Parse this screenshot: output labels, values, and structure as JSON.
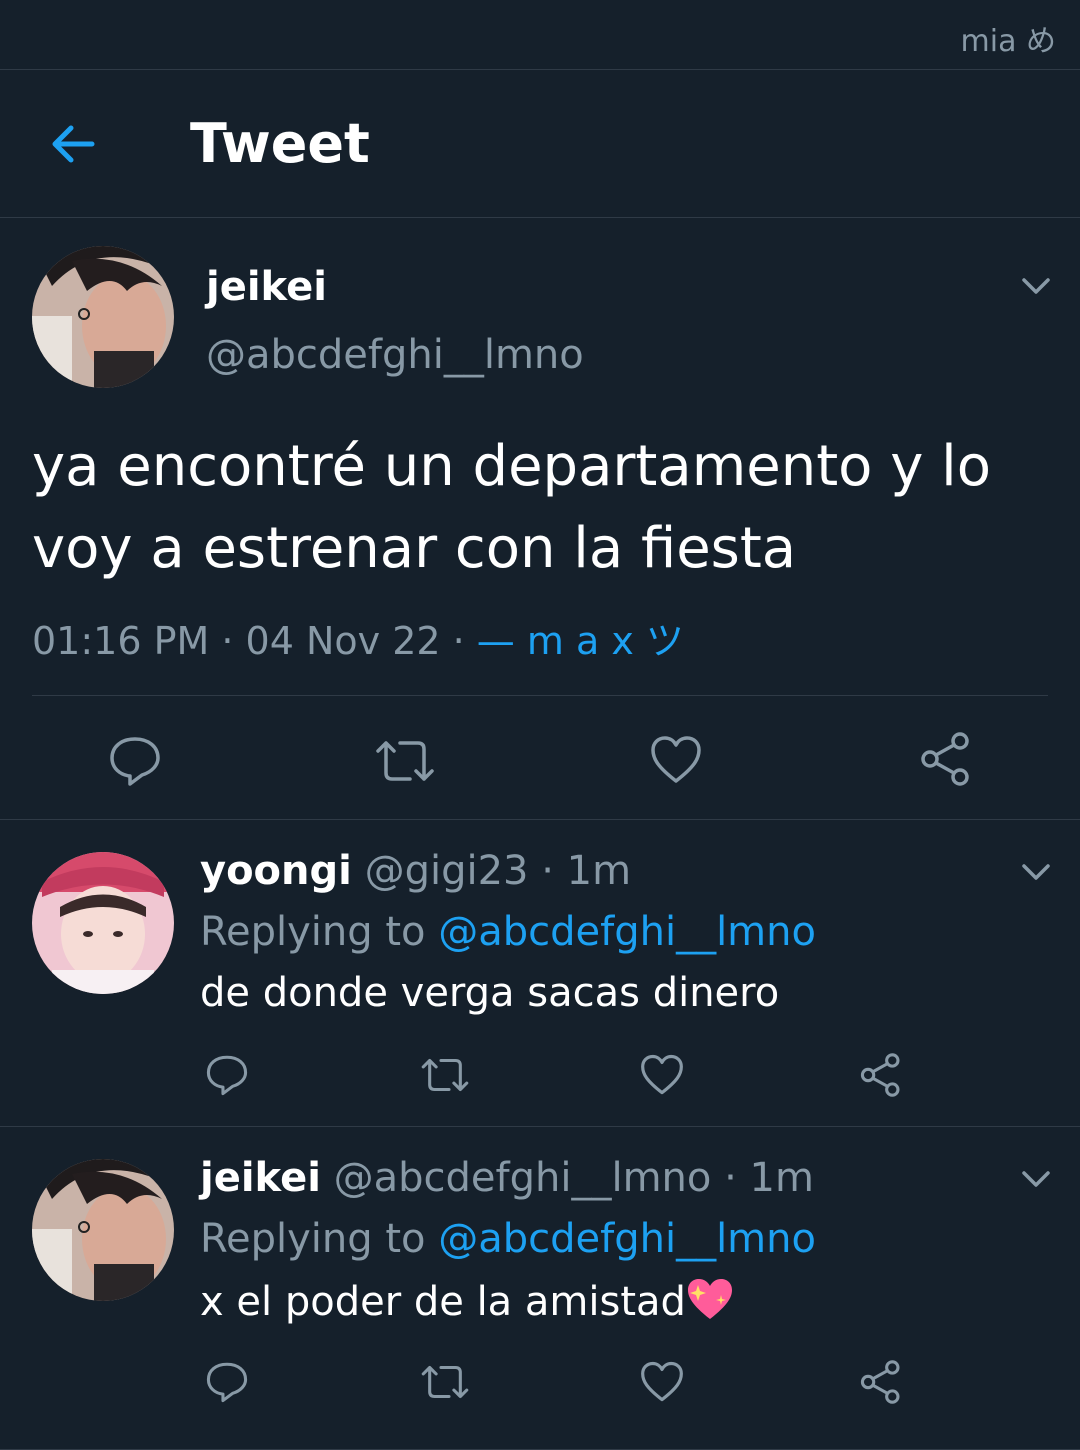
{
  "status_bar": {
    "text": "mia め"
  },
  "header": {
    "title": "Tweet",
    "back_icon": "arrow-left-icon"
  },
  "colors": {
    "background": "#15202b",
    "accent": "#1da1f2",
    "muted": "#8899a6",
    "divider": "#2f3a46"
  },
  "main_tweet": {
    "name": "jeikei",
    "handle": "@abcdefghi__lmno",
    "text": "ya encontré un departamento y lo voy a estrenar con la fiesta",
    "time_date": "01:16 PM · 04 Nov 22 · ",
    "source": "— m a x ツ"
  },
  "replies": [
    {
      "name": "yoongi",
      "handle_time": " @gigi23 · 1m",
      "replying_label": "Replying to ",
      "replying_to": "@abcdefghi__lmno",
      "text": "de donde verga sacas dinero"
    },
    {
      "name": "jeikei",
      "handle_time": " @abcdefghi__lmno · 1m",
      "replying_label": "Replying to ",
      "replying_to": "@abcdefghi__lmno",
      "text": "x el poder de la amistad"
    }
  ]
}
